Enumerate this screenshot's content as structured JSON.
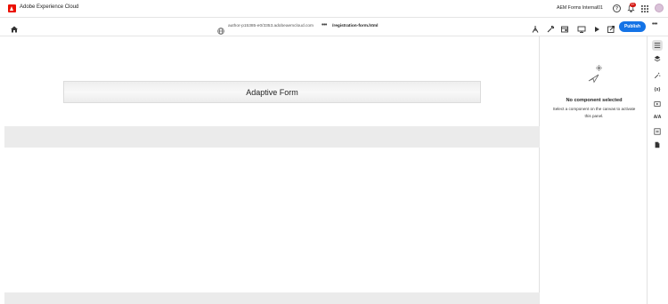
{
  "app": {
    "brand": "Adobe Experience Cloud",
    "org_name": "AEM Forms Internal01",
    "notification_count": "9+"
  },
  "toolbar": {
    "url": "author-p15385-e0/3353.adobeaemcloud.com",
    "more": "•••",
    "page_path": "/registration-form.html",
    "publish_label": "Publish",
    "overflow": "•••"
  },
  "canvas": {
    "form_title": "Adaptive Form"
  },
  "properties_panel": {
    "title": "No component selected",
    "description": "Select a component on the canvas to activate this panel."
  },
  "rail": {
    "variables_label": "{x}",
    "aa_label": "A/A"
  },
  "colors": {
    "accent": "#1473e6",
    "brand": "#eb1000",
    "badge": "#d31510"
  }
}
